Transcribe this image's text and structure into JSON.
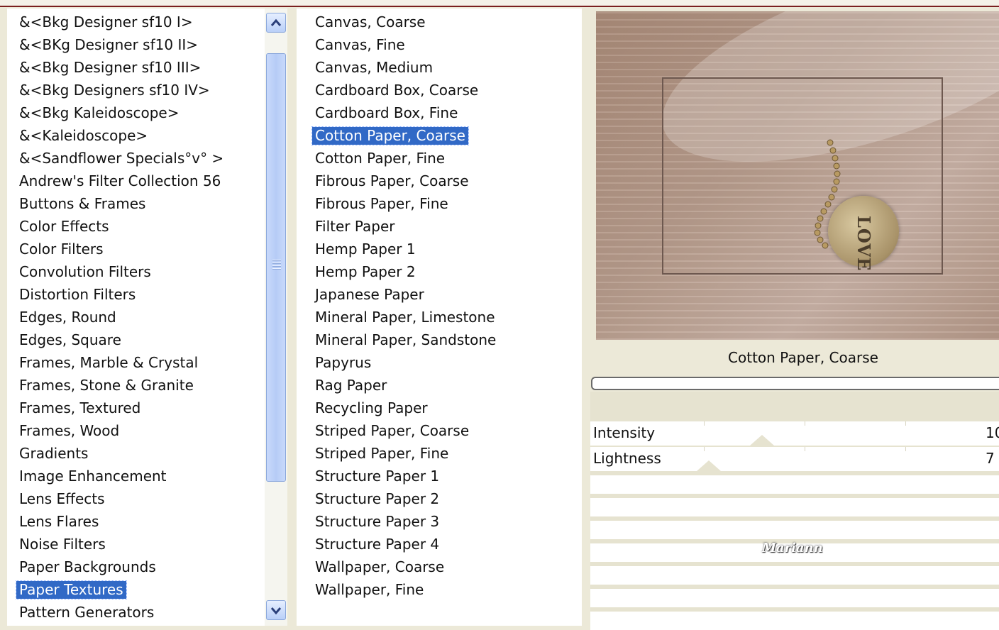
{
  "categories": {
    "items": [
      "&<Bkg Designer sf10 I>",
      "&<BKg Designer sf10 II>",
      "&<Bkg Designer sf10 III>",
      "&<Bkg Designers sf10 IV>",
      "&<Bkg Kaleidoscope>",
      "&<Kaleidoscope>",
      "&<Sandflower Specials°v° >",
      "Andrew's Filter Collection 56",
      "Buttons & Frames",
      "Color Effects",
      "Color Filters",
      "Convolution Filters",
      "Distortion Filters",
      "Edges, Round",
      "Edges, Square",
      "Frames, Marble & Crystal",
      "Frames, Stone & Granite",
      "Frames, Textured",
      "Frames, Wood",
      "Gradients",
      "Image Enhancement",
      "Lens Effects",
      "Lens Flares",
      "Noise Filters",
      "Paper Backgrounds",
      "Paper Textures",
      "Pattern Generators"
    ],
    "selected": "Paper Textures"
  },
  "filters": {
    "items": [
      "Canvas, Coarse",
      "Canvas, Fine",
      "Canvas, Medium",
      "Cardboard Box, Coarse",
      "Cardboard Box, Fine",
      "Cotton Paper, Coarse",
      "Cotton Paper, Fine",
      "Fibrous Paper, Coarse",
      "Fibrous Paper, Fine",
      "Filter Paper",
      "Hemp Paper 1",
      "Hemp Paper 2",
      "Japanese Paper",
      "Mineral Paper, Limestone",
      "Mineral Paper, Sandstone",
      "Papyrus",
      "Rag Paper",
      "Recycling Paper",
      "Striped Paper, Coarse",
      "Striped Paper, Fine",
      "Structure Paper 1",
      "Structure Paper 2",
      "Structure Paper 3",
      "Structure Paper 4",
      "Wallpaper, Coarse",
      "Wallpaper, Fine"
    ],
    "selected": "Cotton Paper, Coarse"
  },
  "preview": {
    "coin_text": "LOVE"
  },
  "selected_filter_name": "Cotton Paper, Coarse",
  "settings": [
    {
      "label": "Intensity",
      "value": "10",
      "level": 0.42
    },
    {
      "label": "Lightness",
      "value": "7",
      "level": 0.29
    }
  ],
  "watermark": "Mariann",
  "colors": {
    "selection": "#3169c6",
    "scrollbar": "#b9cff8",
    "dialog_bg": "#ece9d8"
  }
}
